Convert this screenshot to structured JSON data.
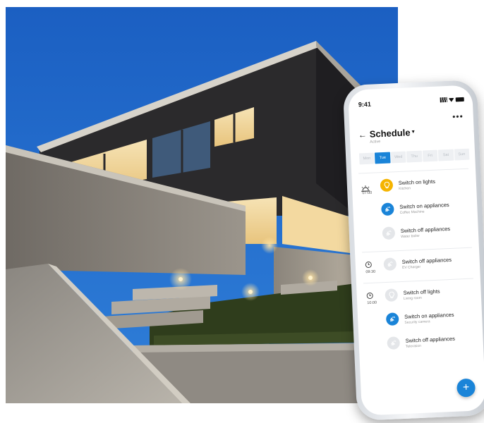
{
  "status_bar": {
    "time": "9:41",
    "more": "•••"
  },
  "schedule": {
    "back_icon": "arrow-left-icon",
    "title": "Schedule",
    "caret": "▾",
    "subtitle": "Active",
    "days": [
      "Mon",
      "Tue",
      "Wed",
      "Thu",
      "Fri",
      "Sat",
      "Sun"
    ],
    "active_day": "Tue",
    "groups": [
      {
        "time": "07:00",
        "icon": "sunrise-icon",
        "items": [
          {
            "title": "Switch on lights",
            "subtitle": "Kitchen",
            "icon": "lightbulb-icon",
            "state": "on"
          },
          {
            "title": "Switch on appliances",
            "subtitle": "Coffee Machine",
            "icon": "plug-icon",
            "state": "plug"
          },
          {
            "title": "Switch off appliances",
            "subtitle": "Water boiler",
            "icon": "plug-icon",
            "state": "off"
          }
        ]
      },
      {
        "time": "09:30",
        "icon": "clock-icon",
        "items": [
          {
            "title": "Switch off appliances",
            "subtitle": "EV Charger",
            "icon": "plug-icon",
            "state": "off"
          }
        ]
      },
      {
        "time": "10:00",
        "icon": "clock-icon",
        "items": [
          {
            "title": "Switch off lights",
            "subtitle": "Living room",
            "icon": "lightbulb-icon",
            "state": "off"
          },
          {
            "title": "Switch on appliances",
            "subtitle": "Security camera",
            "icon": "plug-icon",
            "state": "plug"
          },
          {
            "title": "Switch off appliances",
            "subtitle": "Television",
            "icon": "plug-icon",
            "state": "off"
          }
        ]
      }
    ],
    "fab_label": "+"
  },
  "colors": {
    "accent": "#1a84d8",
    "light_on": "#f5b400",
    "sky": "#1a66c9"
  }
}
